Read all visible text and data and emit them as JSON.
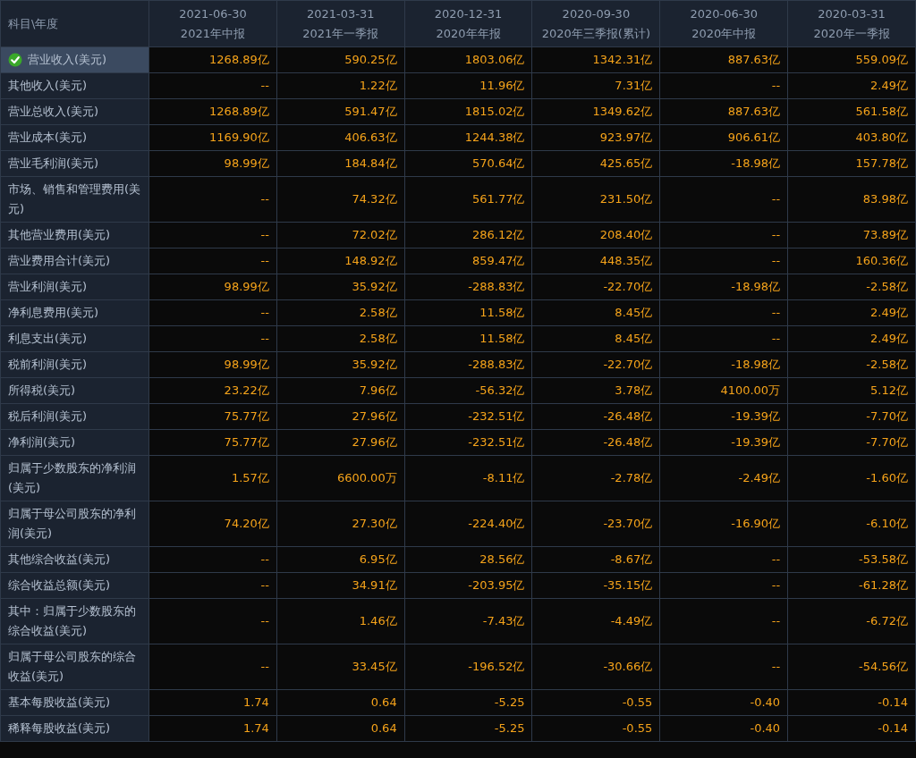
{
  "table": {
    "corner": "科目\\年度",
    "columns": [
      {
        "date": "2021-06-30",
        "report": "2021年中报"
      },
      {
        "date": "2021-03-31",
        "report": "2021年一季报"
      },
      {
        "date": "2020-12-31",
        "report": "2020年年报"
      },
      {
        "date": "2020-09-30",
        "report": "2020年三季报(累计)"
      },
      {
        "date": "2020-06-30",
        "report": "2020年中报"
      },
      {
        "date": "2020-03-31",
        "report": "2020年一季报"
      }
    ],
    "rows": [
      {
        "label": "营业收入(美元)",
        "selected": true,
        "values": [
          "1268.89亿",
          "590.25亿",
          "1803.06亿",
          "1342.31亿",
          "887.63亿",
          "559.09亿"
        ]
      },
      {
        "label": "其他收入(美元)",
        "selected": false,
        "values": [
          "--",
          "1.22亿",
          "11.96亿",
          "7.31亿",
          "--",
          "2.49亿"
        ]
      },
      {
        "label": "营业总收入(美元)",
        "selected": false,
        "values": [
          "1268.89亿",
          "591.47亿",
          "1815.02亿",
          "1349.62亿",
          "887.63亿",
          "561.58亿"
        ]
      },
      {
        "label": "营业成本(美元)",
        "selected": false,
        "values": [
          "1169.90亿",
          "406.63亿",
          "1244.38亿",
          "923.97亿",
          "906.61亿",
          "403.80亿"
        ]
      },
      {
        "label": "营业毛利润(美元)",
        "selected": false,
        "values": [
          "98.99亿",
          "184.84亿",
          "570.64亿",
          "425.65亿",
          "-18.98亿",
          "157.78亿"
        ]
      },
      {
        "label": "市场、销售和管理费用(美元)",
        "selected": false,
        "values": [
          "--",
          "74.32亿",
          "561.77亿",
          "231.50亿",
          "--",
          "83.98亿"
        ]
      },
      {
        "label": "其他营业费用(美元)",
        "selected": false,
        "values": [
          "--",
          "72.02亿",
          "286.12亿",
          "208.40亿",
          "--",
          "73.89亿"
        ]
      },
      {
        "label": "营业费用合计(美元)",
        "selected": false,
        "values": [
          "--",
          "148.92亿",
          "859.47亿",
          "448.35亿",
          "--",
          "160.36亿"
        ]
      },
      {
        "label": "营业利润(美元)",
        "selected": false,
        "values": [
          "98.99亿",
          "35.92亿",
          "-288.83亿",
          "-22.70亿",
          "-18.98亿",
          "-2.58亿"
        ]
      },
      {
        "label": "净利息费用(美元)",
        "selected": false,
        "values": [
          "--",
          "2.58亿",
          "11.58亿",
          "8.45亿",
          "--",
          "2.49亿"
        ]
      },
      {
        "label": "利息支出(美元)",
        "selected": false,
        "values": [
          "--",
          "2.58亿",
          "11.58亿",
          "8.45亿",
          "--",
          "2.49亿"
        ]
      },
      {
        "label": "税前利润(美元)",
        "selected": false,
        "values": [
          "98.99亿",
          "35.92亿",
          "-288.83亿",
          "-22.70亿",
          "-18.98亿",
          "-2.58亿"
        ]
      },
      {
        "label": "所得税(美元)",
        "selected": false,
        "values": [
          "23.22亿",
          "7.96亿",
          "-56.32亿",
          "3.78亿",
          "4100.00万",
          "5.12亿"
        ]
      },
      {
        "label": "税后利润(美元)",
        "selected": false,
        "values": [
          "75.77亿",
          "27.96亿",
          "-232.51亿",
          "-26.48亿",
          "-19.39亿",
          "-7.70亿"
        ]
      },
      {
        "label": "净利润(美元)",
        "selected": false,
        "values": [
          "75.77亿",
          "27.96亿",
          "-232.51亿",
          "-26.48亿",
          "-19.39亿",
          "-7.70亿"
        ]
      },
      {
        "label": "归属于少数股东的净利润(美元)",
        "selected": false,
        "values": [
          "1.57亿",
          "6600.00万",
          "-8.11亿",
          "-2.78亿",
          "-2.49亿",
          "-1.60亿"
        ]
      },
      {
        "label": "归属于母公司股东的净利润(美元)",
        "selected": false,
        "values": [
          "74.20亿",
          "27.30亿",
          "-224.40亿",
          "-23.70亿",
          "-16.90亿",
          "-6.10亿"
        ]
      },
      {
        "label": "其他综合收益(美元)",
        "selected": false,
        "values": [
          "--",
          "6.95亿",
          "28.56亿",
          "-8.67亿",
          "--",
          "-53.58亿"
        ]
      },
      {
        "label": "综合收益总额(美元)",
        "selected": false,
        "values": [
          "--",
          "34.91亿",
          "-203.95亿",
          "-35.15亿",
          "--",
          "-61.28亿"
        ]
      },
      {
        "label": "其中：归属于少数股东的综合收益(美元)",
        "selected": false,
        "values": [
          "--",
          "1.46亿",
          "-7.43亿",
          "-4.49亿",
          "--",
          "-6.72亿"
        ]
      },
      {
        "label": "归属于母公司股东的综合收益(美元)",
        "selected": false,
        "values": [
          "--",
          "33.45亿",
          "-196.52亿",
          "-30.66亿",
          "--",
          "-54.56亿"
        ]
      },
      {
        "label": "基本每股收益(美元)",
        "selected": false,
        "values": [
          "1.74",
          "0.64",
          "-5.25",
          "-0.55",
          "-0.40",
          "-0.14"
        ]
      },
      {
        "label": "稀释每股收益(美元)",
        "selected": false,
        "values": [
          "1.74",
          "0.64",
          "-5.25",
          "-0.55",
          "-0.40",
          "-0.14"
        ]
      }
    ]
  }
}
